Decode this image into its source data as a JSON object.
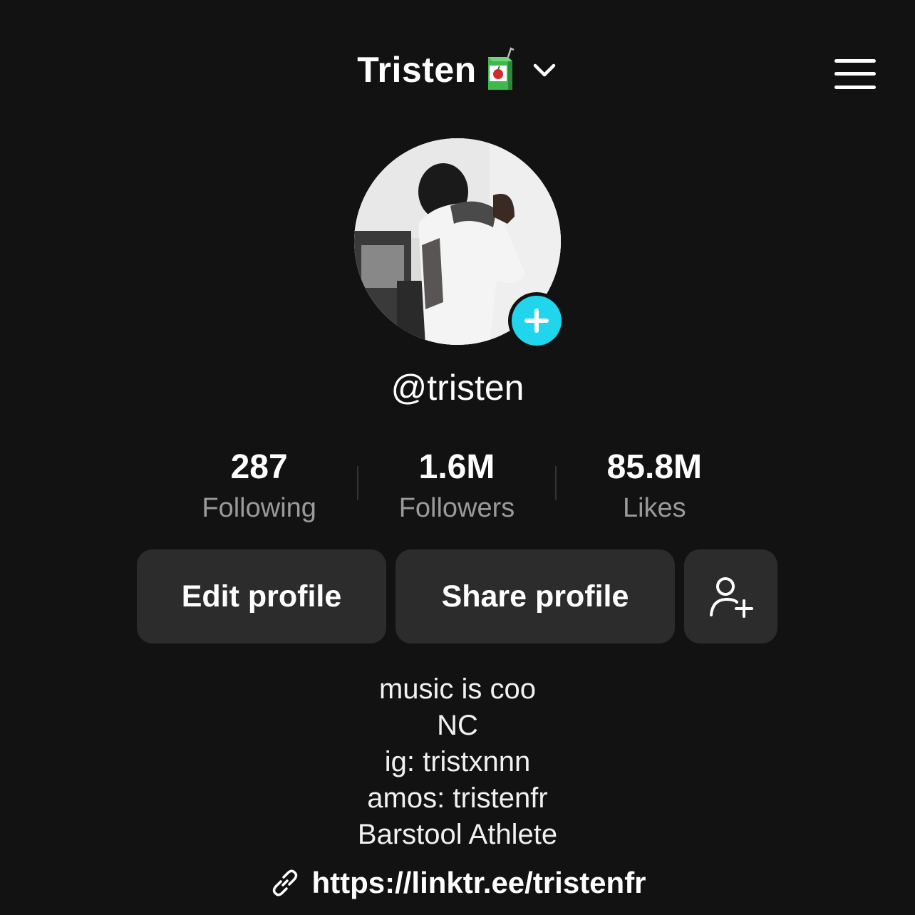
{
  "header": {
    "title": "Tristen",
    "title_emoji_icon": "juice-box-icon",
    "dropdown_icon": "chevron-down-icon",
    "menu_icon": "hamburger-menu-icon"
  },
  "profile": {
    "avatar_icon": "avatar",
    "add_badge_icon": "plus-icon",
    "username": "@tristen"
  },
  "stats": {
    "following": {
      "value": "287",
      "label": "Following"
    },
    "followers": {
      "value": "1.6M",
      "label": "Followers"
    },
    "likes": {
      "value": "85.8M",
      "label": "Likes"
    }
  },
  "actions": {
    "edit_label": "Edit profile",
    "share_label": "Share profile",
    "add_friend_icon": "add-user-icon"
  },
  "bio": {
    "lines": [
      "music is coo",
      "NC",
      "ig: tristxnnn",
      "amos: tristenfr",
      "Barstool Athlete"
    ]
  },
  "link": {
    "icon": "link-icon",
    "url": "https://linktr.ee/tristenfr"
  },
  "colors": {
    "background": "#121212",
    "button_bg": "#2c2c2c",
    "accent": "#20d5ec",
    "muted_text": "#9a9a9a"
  }
}
